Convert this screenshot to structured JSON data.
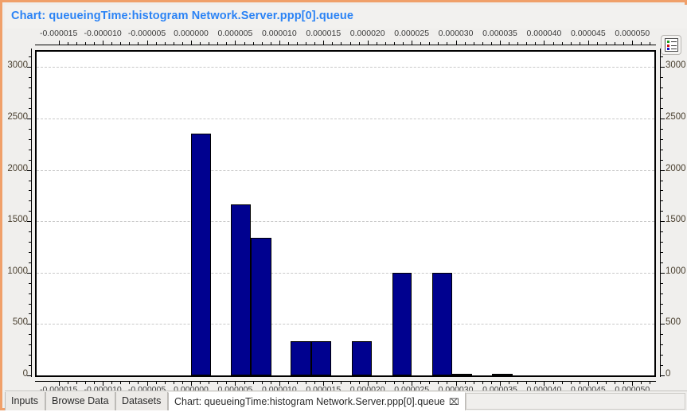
{
  "window": {
    "title": "Chart: queueingTime:histogram Network.Server.ppp[0].queue",
    "title_color": "#2b83f5",
    "border_color": "#f0a06a"
  },
  "toolbar": {
    "legend_button_icon": "legend-list-icon",
    "legend_swatch_colors": [
      "#1f9e1f",
      "#d01010",
      "#1414c8"
    ]
  },
  "chart_data": {
    "type": "bar",
    "title": "queueingTime:histogram Network.Server.ppp[0].queue",
    "xlabel": "",
    "ylabel": "",
    "grid": true,
    "legend_position": "hidden",
    "xlim": [
      -1.75e-05,
      5.25e-05
    ],
    "ylim": [
      0,
      3150
    ],
    "x_tick_labels": [
      "-0.000015",
      "-0.000010",
      "-0.000005",
      "0.000000",
      "0.000005",
      "0.000010",
      "0.000015",
      "0.000020",
      "0.000025",
      "0.000030",
      "0.000035",
      "0.000040",
      "0.000045",
      "0.000050"
    ],
    "x_tick_values": [
      -1.5e-05,
      -1e-05,
      -5e-06,
      0.0,
      5e-06,
      1e-05,
      1.5e-05,
      2e-05,
      2.5e-05,
      3e-05,
      3.5e-05,
      4e-05,
      4.5e-05,
      5e-05
    ],
    "y_tick_labels": [
      "0",
      "500",
      "1000",
      "1500",
      "2000",
      "2500",
      "3000"
    ],
    "y_tick_values": [
      0,
      500,
      1000,
      1500,
      2000,
      2500,
      3000
    ],
    "axes": [
      "top",
      "bottom",
      "left",
      "right"
    ],
    "bars": [
      {
        "bin_start": 0.0,
        "bin_end": 2.3e-06,
        "value": 2353
      },
      {
        "bin_start": 4.5e-06,
        "bin_end": 6.8e-06,
        "value": 1667
      },
      {
        "bin_start": 6.8e-06,
        "bin_end": 9.1e-06,
        "value": 1340
      },
      {
        "bin_start": 1.13e-05,
        "bin_end": 1.36e-05,
        "value": 333
      },
      {
        "bin_start": 1.36e-05,
        "bin_end": 1.59e-05,
        "value": 333
      },
      {
        "bin_start": 1.82e-05,
        "bin_end": 2.05e-05,
        "value": 333
      },
      {
        "bin_start": 2.28e-05,
        "bin_end": 2.5e-05,
        "value": 1000
      },
      {
        "bin_start": 2.73e-05,
        "bin_end": 2.96e-05,
        "value": 1000
      },
      {
        "bin_start": 2.96e-05,
        "bin_end": 3.18e-05,
        "value": 10
      },
      {
        "bin_start": 3.41e-05,
        "bin_end": 3.64e-05,
        "value": 8
      }
    ],
    "bar_color": "#00018f",
    "bar_edge_color": "#000000"
  },
  "tabs": [
    {
      "label": "Inputs",
      "active": false,
      "closable": false
    },
    {
      "label": "Browse Data",
      "active": false,
      "closable": false
    },
    {
      "label": "Datasets",
      "active": false,
      "closable": false
    },
    {
      "label": "Chart: queueingTime:histogram Network.Server.ppp[0].queue",
      "active": true,
      "closable": true,
      "close_icon": "close-icon"
    }
  ]
}
